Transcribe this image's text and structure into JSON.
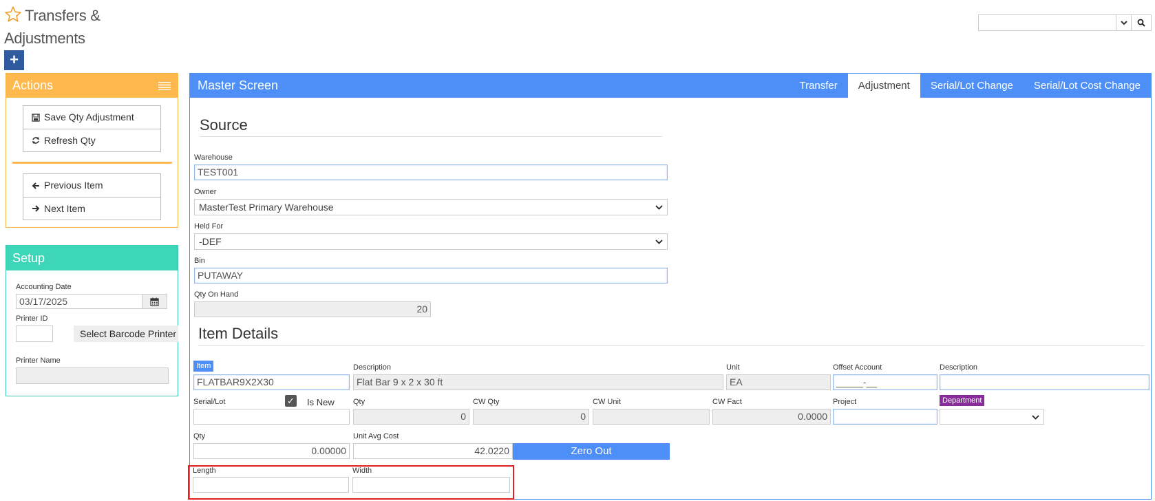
{
  "header": {
    "title_line1": "Transfers &",
    "title_line2": "Adjustments",
    "add_label": "+",
    "search_value": ""
  },
  "actions": {
    "title": "Actions",
    "buttons": [
      "Save Qty Adjustment",
      "Refresh Qty",
      "Previous Item",
      "Next Item"
    ]
  },
  "setup": {
    "title": "Setup",
    "accounting_date_label": "Accounting Date",
    "accounting_date": "03/17/2025",
    "printer_id_label": "Printer ID",
    "printer_id": "",
    "select_printer_label": "Select Barcode Printer",
    "printer_name_label": "Printer Name",
    "printer_name": ""
  },
  "main": {
    "title": "Master Screen",
    "tabs": [
      "Transfer",
      "Adjustment",
      "Serial/Lot Change",
      "Serial/Lot Cost Change"
    ],
    "active_tab": "Adjustment",
    "source": {
      "title": "Source",
      "warehouse_label": "Warehouse",
      "warehouse": "TEST001",
      "owner_label": "Owner",
      "owner": "MasterTest Primary Warehouse",
      "held_for_label": "Held For",
      "held_for": "-DEF",
      "bin_label": "Bin",
      "bin": "PUTAWAY",
      "qty_on_hand_label": "Qty On Hand",
      "qty_on_hand": "20"
    },
    "item": {
      "title": "Item Details",
      "item_label": "Item",
      "item": "FLATBAR9X2X30",
      "description_label": "Description",
      "description": "Flat Bar 9 x 2 x 30 ft",
      "unit_label": "Unit",
      "unit": "EA",
      "offset_account_label": "Offset Account",
      "offset_account": "_____-__",
      "description2_label": "Description",
      "description2": "",
      "serial_lot_label": "Serial/Lot",
      "is_new_label": "Is New",
      "serial_lot": "",
      "qty_label": "Qty",
      "qty_ro": "0",
      "cw_qty_label": "CW Qty",
      "cw_qty": "0",
      "cw_unit_label": "CW Unit",
      "cw_unit": "",
      "cw_fact_label": "CW Fact",
      "cw_fact": "0.0000",
      "project_label": "Project",
      "project": "",
      "department_label": "Department",
      "department": "",
      "qty2_label": "Qty",
      "qty2": "0.00000",
      "unit_avg_cost_label": "Unit Avg Cost",
      "unit_avg_cost": "42.0220",
      "zero_out_label": "Zero Out",
      "length_label": "Length",
      "length": "",
      "width_label": "Width",
      "width": ""
    }
  },
  "colors": {
    "actions": "#ffb84d",
    "setup": "#3dd6b8",
    "main": "#4d8ef7",
    "department_tag": "#8a2b9c",
    "highlight": "#e02020"
  }
}
